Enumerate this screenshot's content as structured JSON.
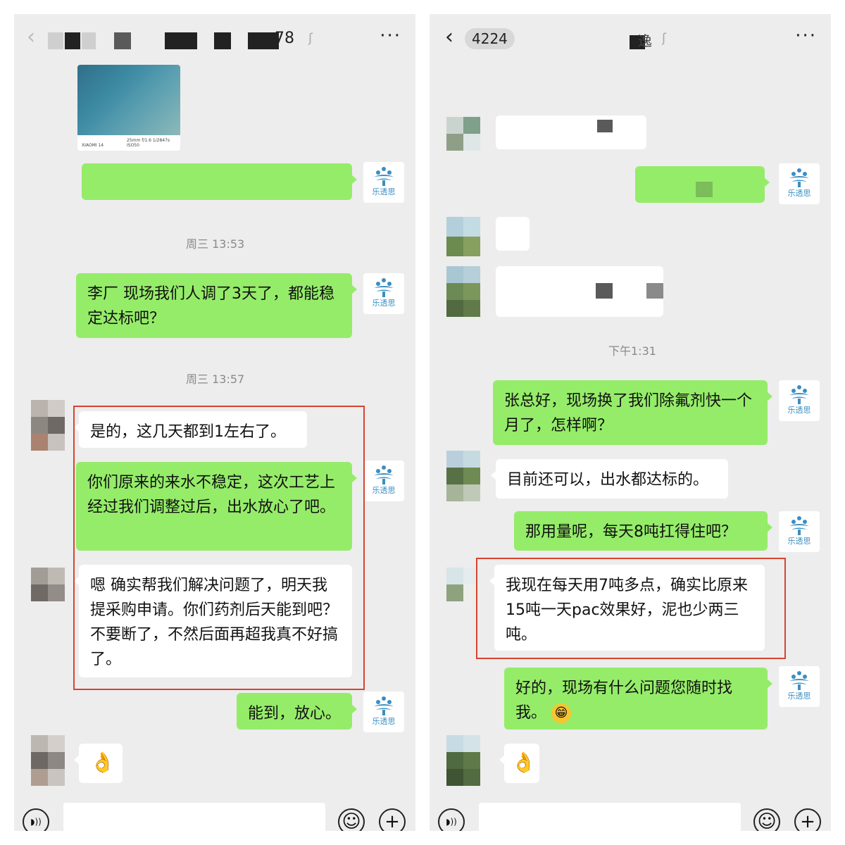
{
  "left": {
    "header": {
      "title_suffix": "78"
    },
    "times": [
      "周三 13:53",
      "周三 13:57"
    ],
    "messages": [
      "李厂 现场我们人调了3天了，都能稳定达标吧？",
      "是的，这几天都到1左右了。",
      "你们原来的来水不稳定，这次工艺上经过我们调整过后，出水放心了吧。",
      "嗯 确实帮我们解决问题了，明天我提采购申请。你们药剂后天能到吧？不要断了，不然后面再超我真不好搞了。",
      "能到，放心。"
    ],
    "photo_caption": "XIAOMI 14",
    "photo_specs": "25mm f/1.6 1/2847s ISO50"
  },
  "right": {
    "header": {
      "badge": "4224",
      "title": "逸"
    },
    "times": [
      "下午1:31"
    ],
    "messages": [
      "张总好，现场换了我们除氟剂快一个月了，怎样啊？",
      "目前还可以，出水都达标的。",
      "那用量呢，每天8吨扛得住吧？",
      "我现在每天用7吨多点，确实比原来15吨一天pac效果好，泥也少两三吨。",
      "好的，现场有什么问题您随时找我。"
    ]
  },
  "common": {
    "logo_text": "乐透思",
    "back_glyph": "‹",
    "more_glyph": "···",
    "emoji_ok": "👌",
    "emoji_grin": "😁",
    "plus_glyph": "+",
    "smile_glyph": "☺",
    "voice_glyph": "◗))",
    "ear_glyph": "ʃ"
  },
  "colors": {
    "bubble_green": "#95ec69",
    "bubble_white": "#ffffff",
    "highlight_red": "#d8432f",
    "logo_blue": "#3b8ec2"
  }
}
